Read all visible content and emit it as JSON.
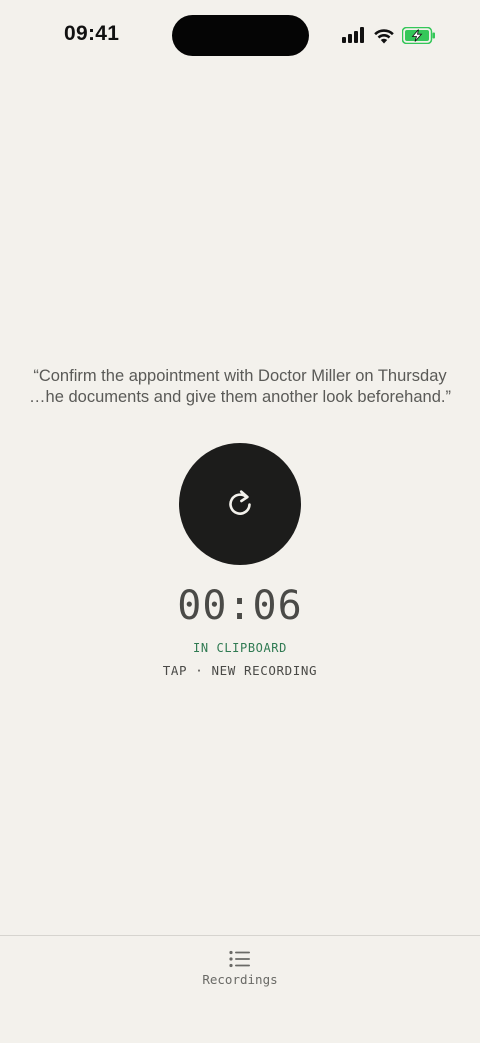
{
  "status_bar": {
    "time": "09:41",
    "icons": [
      "signal-icon",
      "wifi-icon",
      "battery-charging-icon"
    ],
    "battery_color": "#34c759"
  },
  "transcript": {
    "text": "“Confirm the appointment with Doctor Miller on Thursday\n…he documents and give them another look beforehand.”"
  },
  "record_button": {
    "icon": "refresh-icon",
    "background": "#1c1c1b"
  },
  "timer": {
    "value": "00:06"
  },
  "status": {
    "label": "IN CLIPBOARD",
    "color": "#2f7a52"
  },
  "hint": {
    "label": "TAP · NEW RECORDING"
  },
  "tab_bar": {
    "recordings_label": "Recordings",
    "recordings_icon": "list-icon"
  }
}
